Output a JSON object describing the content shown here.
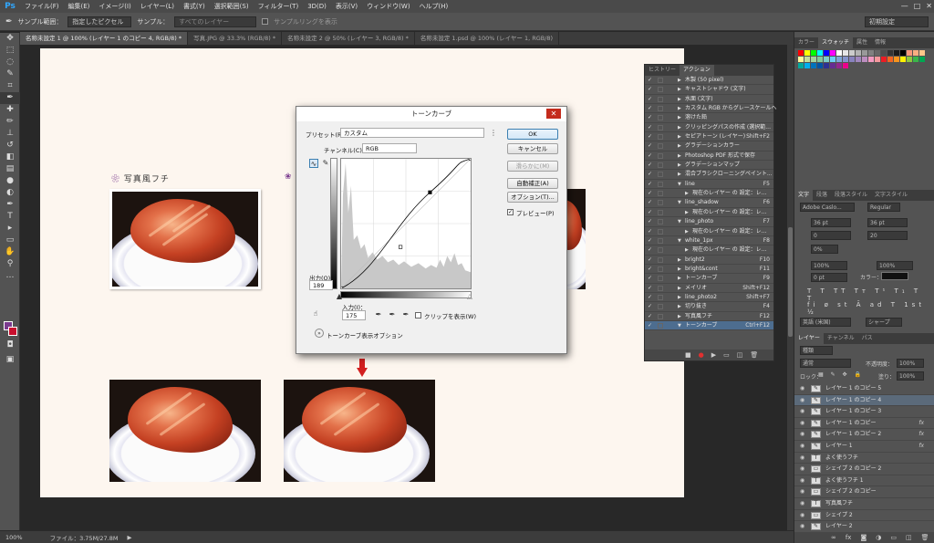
{
  "app": {
    "logo": "Ps"
  },
  "menu": [
    "ファイル(F)",
    "編集(E)",
    "イメージ(I)",
    "レイヤー(L)",
    "書式(Y)",
    "選択範囲(S)",
    "フィルター(T)",
    "3D(D)",
    "表示(V)",
    "ウィンドウ(W)",
    "ヘルプ(H)"
  ],
  "window_controls": [
    "—",
    "□",
    "✕"
  ],
  "options_bar": {
    "tool_icon": "eyedropper-icon",
    "sample_size_label": "サンプル範囲：",
    "sample_size_value": "指定したピクセル",
    "sample_label": "サンプル：",
    "sample_value": "すべてのレイヤー",
    "show_ring_label": "サンプルリングを表示",
    "workspace": "初期設定"
  },
  "tabs": [
    "名称未設定 1 @ 100% (レイヤー 1 のコピー 4, RGB/8) *",
    "写真.JPG @ 33.3% (RGB/8) *",
    "名称未設定 2 @ 50% (レイヤー 3, RGB/8) *",
    "名称未設定 1.psd @ 100% (レイヤー 1, RGB/8)"
  ],
  "document": {
    "label": "写真風フチ",
    "flower": "❀"
  },
  "status_bar": {
    "zoom": "100%",
    "file_info": "ファイル：3.75M/27.8M"
  },
  "curves_dialog": {
    "title": "トーンカーブ",
    "preset_label": "プリセット(R)：",
    "preset_value": "カスタム",
    "channel_label": "チャンネル(C)：",
    "channel_value": "RGB",
    "output_label": "出力(O)：",
    "output_value": "189",
    "input_label": "入力(I)：",
    "input_value": "175",
    "show_clipping_label": "クリップを表示(W)",
    "display_options_label": "トーンカーブ表示オプション",
    "buttons": {
      "ok": "OK",
      "cancel": "キャンセル",
      "smooth": "滑らかに(M)",
      "auto": "自動補正(A)",
      "options": "オプション(T)..."
    },
    "preview_label": "プレビュー(P)",
    "preview_checked": true,
    "curve_points": [
      [
        0,
        0
      ],
      [
        175,
        189
      ],
      [
        255,
        255
      ]
    ]
  },
  "actions_panel": {
    "tabs": [
      "ヒストリー",
      "アクション"
    ],
    "rows": [
      {
        "name": "木製 (50 pixel)",
        "key": "",
        "indent": 0,
        "expanded": false
      },
      {
        "name": "キャストシャドウ (文字)",
        "key": "",
        "indent": 0,
        "expanded": false
      },
      {
        "name": "水面 (文字)",
        "key": "",
        "indent": 0,
        "expanded": false
      },
      {
        "name": "カスタム RGB からグレースケールへ",
        "key": "",
        "indent": 0,
        "expanded": false
      },
      {
        "name": "溶けた鉛",
        "key": "",
        "indent": 0,
        "expanded": false
      },
      {
        "name": "クリッピングパスの作成 (選択範...",
        "key": "",
        "indent": 0,
        "expanded": false
      },
      {
        "name": "セピアトーン (レイヤー)",
        "key": "Shift+F2",
        "indent": 0,
        "expanded": false
      },
      {
        "name": "グラデーションカラー",
        "key": "",
        "indent": 0,
        "expanded": false
      },
      {
        "name": "Photoshop PDF 形式で保存",
        "key": "",
        "indent": 0,
        "expanded": false
      },
      {
        "name": "グラデーションマップ",
        "key": "",
        "indent": 0,
        "expanded": false
      },
      {
        "name": "混合ブラシクローニングペイント...",
        "key": "",
        "indent": 0,
        "expanded": false
      },
      {
        "name": "line",
        "key": "F5",
        "indent": 0,
        "expanded": true
      },
      {
        "name": "現在のレイヤー の 設定：レ...",
        "key": "",
        "indent": 1,
        "expanded": false
      },
      {
        "name": "line_shadow",
        "key": "F6",
        "indent": 0,
        "expanded": true
      },
      {
        "name": "現在のレイヤー の 設定：レ...",
        "key": "",
        "indent": 1,
        "expanded": false
      },
      {
        "name": "line_photo",
        "key": "F7",
        "indent": 0,
        "expanded": true
      },
      {
        "name": "現在のレイヤー の 設定：レ...",
        "key": "",
        "indent": 1,
        "expanded": false
      },
      {
        "name": "white_1px",
        "key": "F8",
        "indent": 0,
        "expanded": true
      },
      {
        "name": "現在のレイヤー の 設定：レ...",
        "key": "",
        "indent": 1,
        "expanded": false
      },
      {
        "name": "bright2",
        "key": "F10",
        "indent": 0,
        "expanded": false
      },
      {
        "name": "bright&cont",
        "key": "F11",
        "indent": 0,
        "expanded": false
      },
      {
        "name": "トーンカーブ",
        "key": "F9",
        "indent": 0,
        "expanded": false
      },
      {
        "name": "メイリオ",
        "key": "Shift+F12",
        "indent": 0,
        "expanded": false
      },
      {
        "name": "line_photo2",
        "key": "Shift+F7",
        "indent": 0,
        "expanded": false
      },
      {
        "name": "切り抜き",
        "key": "F4",
        "indent": 0,
        "expanded": false
      },
      {
        "name": "写真風フチ",
        "key": "F12",
        "indent": 0,
        "expanded": false
      },
      {
        "name": "トーンカーブ",
        "key": "Ctrl+F12",
        "indent": 0,
        "expanded": true,
        "selected": true
      }
    ]
  },
  "dock": {
    "swatch_tabs": [
      "カラー",
      "スウォッチ",
      "属性",
      "情報"
    ],
    "char_tabs": [
      "文字",
      "段落",
      "段落スタイル",
      "文字スタイル"
    ],
    "font_family": "Adobe Caslo...",
    "font_style": "Regular",
    "font_size": "36 pt",
    "leading": "36 pt",
    "kerning": "0",
    "tracking": "20",
    "color_label": "カラー：",
    "aa_label": "英語 (米国)",
    "sharp": "シャープ",
    "vscale": "100%",
    "hscale": "100%",
    "baseline": "0 pt",
    "percent": "0%",
    "layers_tabs": [
      "レイヤー",
      "チャンネル",
      "パス"
    ],
    "kind_label": "種類",
    "blend_mode": "通常",
    "opacity_label": "不透明度：",
    "opacity_value": "100%",
    "lock_label": "ロック：",
    "fill_label": "塗り：",
    "fill_value": "100%",
    "layers": [
      {
        "name": "レイヤー 1 のコピー 5",
        "thumb": "brush",
        "fx": false
      },
      {
        "name": "レイヤー 1 のコピー 4",
        "thumb": "brush",
        "fx": false,
        "selected": true
      },
      {
        "name": "レイヤー 1 のコピー 3",
        "thumb": "brush",
        "fx": false
      },
      {
        "name": "レイヤー 1 のコピー",
        "thumb": "brush",
        "fx": true
      },
      {
        "name": "レイヤー 1 のコピー 2",
        "thumb": "brush",
        "fx": true
      },
      {
        "name": "レイヤー 1",
        "thumb": "brush",
        "fx": true
      },
      {
        "name": "よく使うフチ",
        "thumb": "T",
        "fx": false
      },
      {
        "name": "シェイプ 2 のコピー 2",
        "thumb": "shape",
        "fx": false
      },
      {
        "name": "よく使うフチ 1",
        "thumb": "T",
        "fx": false
      },
      {
        "name": "シェイプ 2 のコピー",
        "thumb": "shape",
        "fx": false
      },
      {
        "name": "写真風フチ",
        "thumb": "T",
        "fx": false
      },
      {
        "name": "シェイプ 2",
        "thumb": "shape",
        "fx": false
      },
      {
        "name": "レイヤー 2",
        "thumb": "brush",
        "fx": false
      }
    ],
    "footer_icons": [
      "link-icon",
      "fx-icon",
      "mask-icon",
      "adjustment-icon",
      "folder-icon",
      "new-layer-icon",
      "trash-icon"
    ]
  },
  "colors": {
    "foreground": "#7a3b8e",
    "background": "#c8102e",
    "arrow": "#d22020"
  }
}
